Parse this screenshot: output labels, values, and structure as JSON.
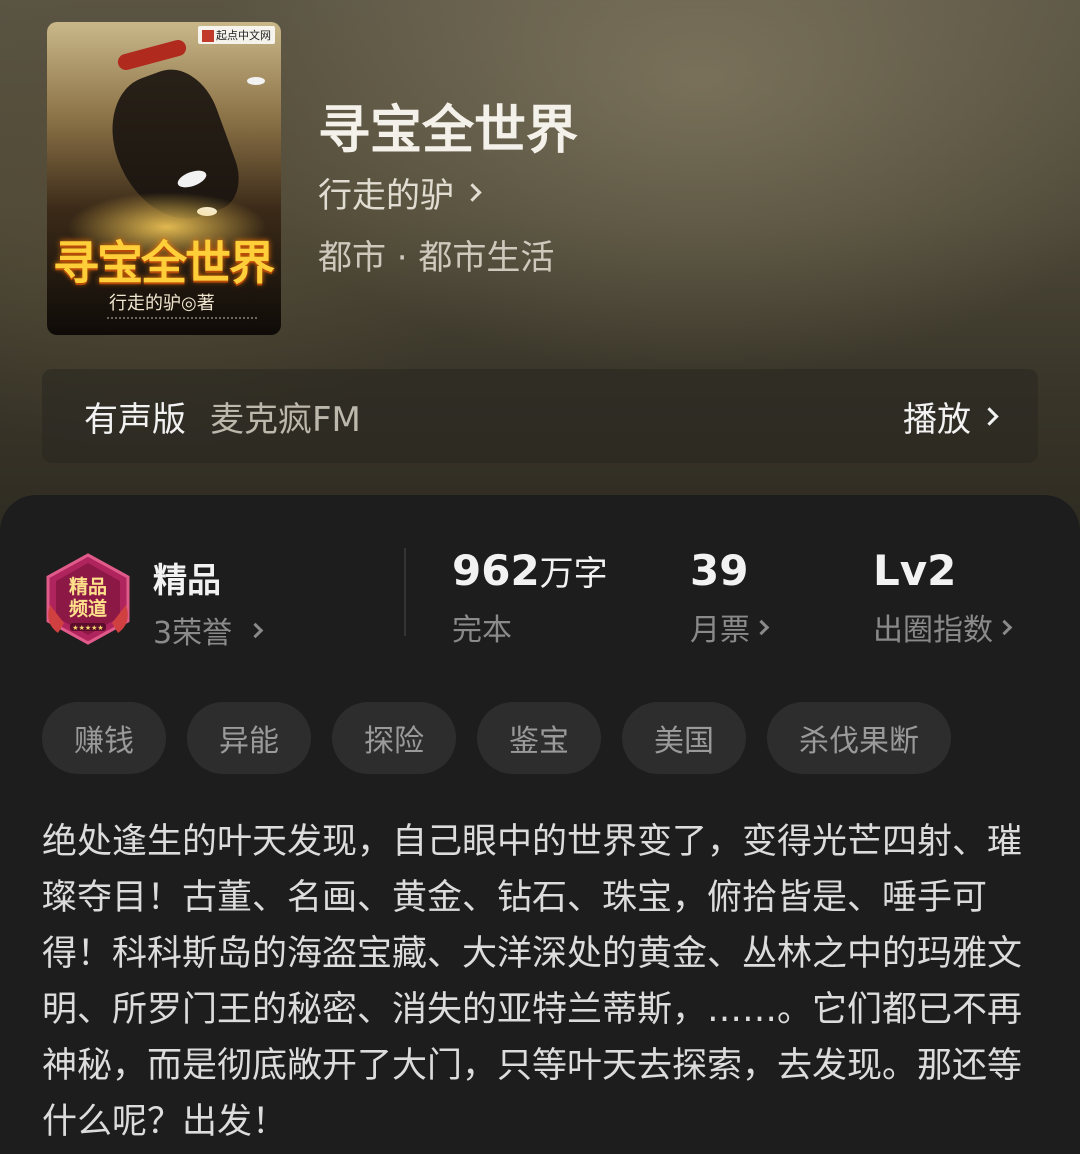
{
  "book": {
    "title": "寻宝全世界",
    "author": "行走的驴",
    "genre": "都市 · 都市生活",
    "cover": {
      "title": "寻宝全世界",
      "author": "行走的驴◎著",
      "publisher": "起点中文网"
    }
  },
  "audio": {
    "label": "有声版",
    "source": "麦克疯FM",
    "action": "播放"
  },
  "stats": {
    "badge": {
      "name": "精品",
      "honor": "3荣誉",
      "seal_text": "精品频道"
    },
    "words": {
      "value": "962",
      "unit": "万字",
      "status": "完本"
    },
    "tickets": {
      "value": "39",
      "label": "月票"
    },
    "level": {
      "value": "Lv2",
      "label": "出圈指数"
    }
  },
  "tags": [
    "赚钱",
    "异能",
    "探险",
    "鉴宝",
    "美国",
    "杀伐果断"
  ],
  "synopsis": "绝处逢生的叶天发现，自己眼中的世界变了，变得光芒四射、璀璨夺目！古董、名画、黄金、钻石、珠宝，俯拾皆是、唾手可得！科科斯岛的海盗宝藏、大洋深处的黄金、丛林之中的玛雅文明、所罗门王的秘密、消失的亚特兰蒂斯，……。它们都已不再神秘，而是彻底敞开了大门，只等叶天去探索，去发现。那还等什么呢？出发！",
  "colors": {
    "panel": "#1d1d1d",
    "tag_bg": "#2d2d2d",
    "badge_magenta": "#b0245e"
  }
}
